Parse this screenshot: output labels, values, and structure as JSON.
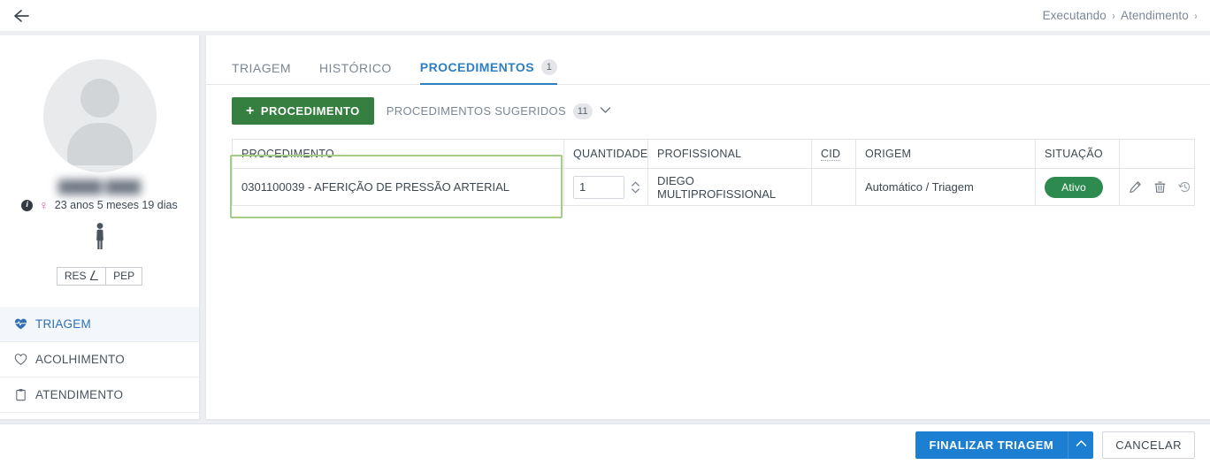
{
  "topbar": {
    "back_icon": "arrow-left-icon",
    "breadcrumb": {
      "items": [
        "Executando",
        "Atendimento"
      ],
      "separator": "›"
    }
  },
  "sidebar": {
    "avatar_icon": "person-placeholder-avatar",
    "patient_name_redacted": "█████ ████",
    "info_icon": "info-icon",
    "gender_icon": "female-symbol-icon",
    "age": "23 anos 5 meses 19 dias",
    "body_figure_icon": "pregnant-body-figure-icon",
    "segmented": [
      {
        "label": "RES",
        "icon": "external-link-icon"
      },
      {
        "label": "PEP",
        "icon": ""
      }
    ],
    "items": [
      {
        "label": "TRIAGEM",
        "icon": "heartbeat-icon",
        "active": true
      },
      {
        "label": "ACOLHIMENTO",
        "icon": "heart-outline-icon",
        "active": false
      },
      {
        "label": "ATENDIMENTO",
        "icon": "clipboard-icon",
        "active": false
      }
    ]
  },
  "content": {
    "tabs": [
      {
        "label": "TRIAGEM",
        "count": "",
        "active": false
      },
      {
        "label": "HISTÓRICO",
        "count": "",
        "active": false
      },
      {
        "label": "PROCEDIMENTOS",
        "count": "1",
        "active": true
      }
    ],
    "actionbar": {
      "add_plus": "+",
      "add_label": "PROCEDIMENTO",
      "suggested_label": "PROCEDIMENTOS SUGERIDOS",
      "suggested_count": "11",
      "suggested_chevron_icon": "chevron-down-icon"
    },
    "table": {
      "headers": {
        "procedimento": "PROCEDIMENTO",
        "quantidade": "QUANTIDADE",
        "profissional": "PROFISSIONAL",
        "cid": "CID",
        "origem": "ORIGEM",
        "situacao": "SITUAÇÃO",
        "actions": ""
      },
      "rows": [
        {
          "procedimento": "0301100039 - AFERIÇÃO DE PRESSÃO ARTERIAL",
          "quantidade": "1",
          "profissional": "DIEGO MULTIPROFISSIONAL",
          "cid": "",
          "origem": "Automático / Triagem",
          "situacao": "Ativo",
          "actions": [
            "edit-pencil-icon",
            "trash-icon",
            "history-restore-icon"
          ]
        }
      ]
    }
  },
  "footer": {
    "primary_label": "FINALIZAR TRIAGEM",
    "primary_caret_icon": "chevron-up-icon",
    "cancel_label": "CANCELAR"
  },
  "colors": {
    "accent_blue": "#2d7fc1",
    "primary_blue": "#1d7fd1",
    "add_green": "#357f41",
    "badge_green": "#2e8b50",
    "highlight_green": "#a6cc8a",
    "gender_pink": "#e0509a",
    "page_bg": "#eceef1"
  }
}
